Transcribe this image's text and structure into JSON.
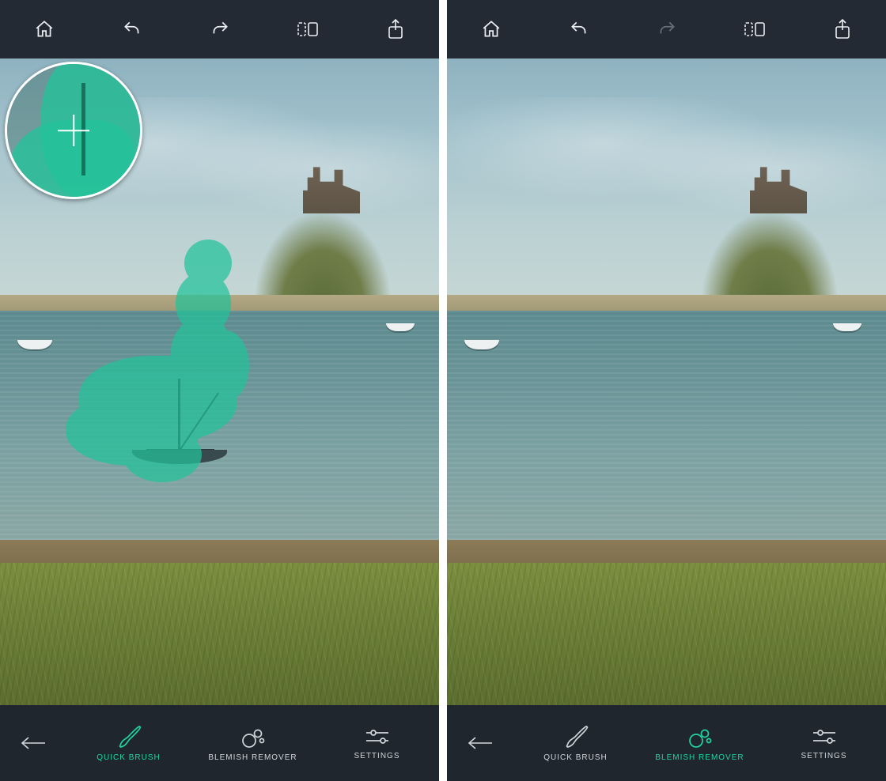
{
  "colors": {
    "accent": "#1fd6a2",
    "mask": "#22c39a",
    "toolbar": "#20262e",
    "topbar": "#232a33"
  },
  "topbar": {
    "items": [
      {
        "name": "home-icon"
      },
      {
        "name": "undo-icon"
      },
      {
        "name": "redo-icon"
      },
      {
        "name": "compare-icon"
      },
      {
        "name": "share-icon"
      }
    ]
  },
  "toolbar": {
    "back_name": "back-icon",
    "tools": {
      "quick_brush": {
        "label": "QUICK BRUSH"
      },
      "blemish_remover": {
        "label": "BLEMISH REMOVER"
      },
      "settings": {
        "label": "SETTINGS"
      }
    }
  },
  "panes": {
    "left": {
      "active_tool": "quick_brush",
      "redo_disabled": false,
      "show_mask": true,
      "show_sailboat": true,
      "show_loupe": true
    },
    "right": {
      "active_tool": "blemish_remover",
      "redo_disabled": true,
      "show_mask": false,
      "show_sailboat": false,
      "show_loupe": false
    }
  }
}
